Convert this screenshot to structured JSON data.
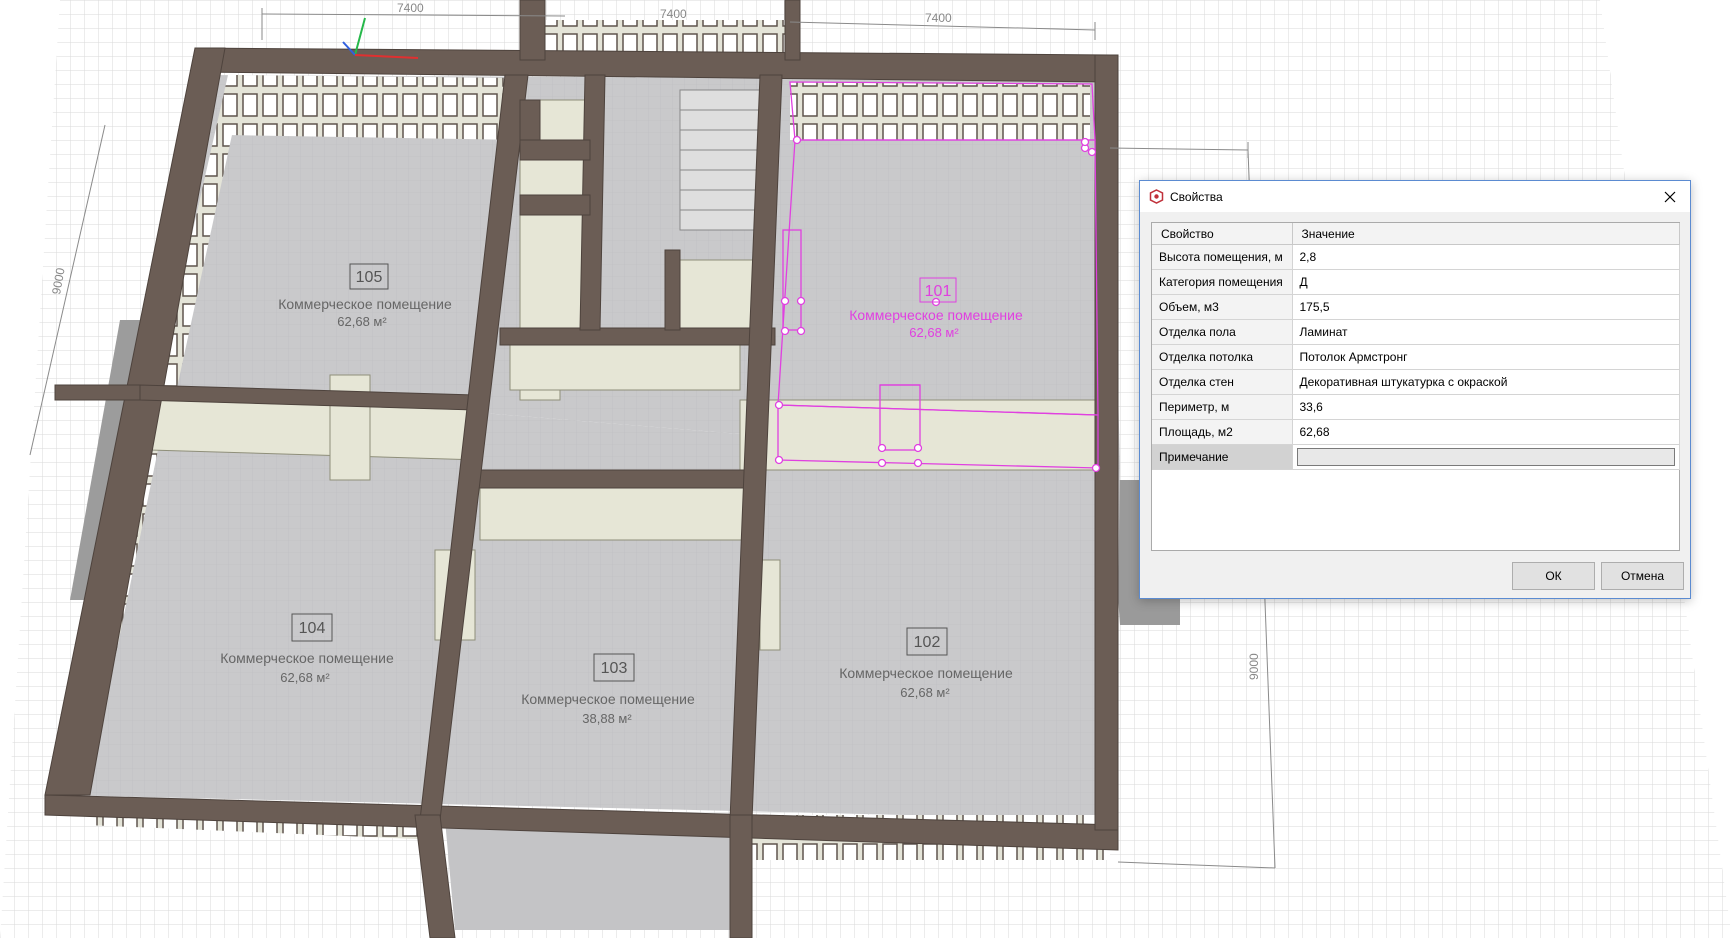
{
  "viewport": {
    "dimensions": [
      {
        "id": "top-left",
        "text": "7400"
      },
      {
        "id": "top-mid",
        "text": "7400"
      },
      {
        "id": "top-right",
        "text": "7400"
      },
      {
        "id": "left",
        "text": "9000"
      },
      {
        "id": "right",
        "text": "9000"
      }
    ],
    "rooms": [
      {
        "number": "105",
        "name": "Коммерческое помещение",
        "area": "62,68 м²"
      },
      {
        "number": "101",
        "name": "Коммерческое помещение",
        "area": "62,68 м²"
      },
      {
        "number": "104",
        "name": "Коммерческое помещение",
        "area": "62,68 м²"
      },
      {
        "number": "103",
        "name": "Коммерческое помещение",
        "area": "38,88 м²"
      },
      {
        "number": "102",
        "name": "Коммерческое помещение",
        "area": "62,68 м²"
      }
    ],
    "colors": {
      "wall": "#6b5d55",
      "wall_dark": "#4e433d",
      "floor": "#c8c8ca",
      "inner_wall": "#e6e6d6",
      "selection": "#e040e0",
      "grid": "#d6d6d6"
    }
  },
  "dialog": {
    "title": "Свойства",
    "app_icon": "app-logo-icon",
    "close_icon": "close-icon",
    "header": {
      "property": "Свойство",
      "value": "Значение"
    },
    "rows": [
      {
        "name": "Высота помещения, м",
        "value": "2,8"
      },
      {
        "name": "Категория помещения",
        "value": "Д"
      },
      {
        "name": "Объем, м3",
        "value": "175,5"
      },
      {
        "name": "Отделка пола",
        "value": "Ламинат"
      },
      {
        "name": "Отделка потолка",
        "value": "Потолок Армстронг"
      },
      {
        "name": "Отделка стен",
        "value": "Декоративная штукатурка с окраской"
      },
      {
        "name": "Периметр, м",
        "value": "33,6"
      },
      {
        "name": "Площадь, м2",
        "value": "62,68"
      },
      {
        "name": "Примечание",
        "value": ""
      }
    ],
    "ok_label": "ОК",
    "cancel_label": "Отмена"
  }
}
